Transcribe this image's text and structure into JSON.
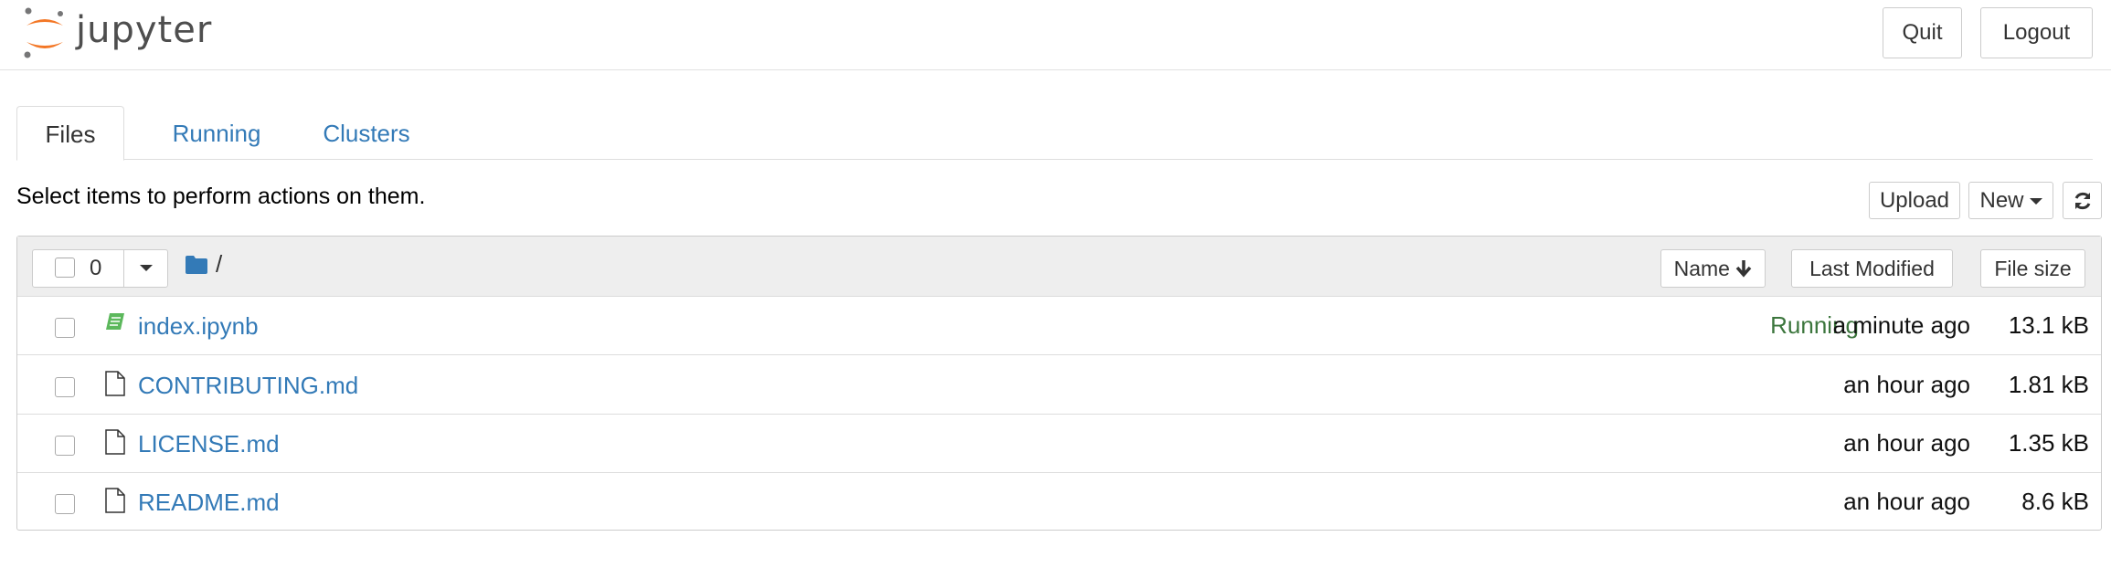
{
  "app": {
    "logo_text": "jupyter"
  },
  "header": {
    "quit_label": "Quit",
    "logout_label": "Logout"
  },
  "tabs": [
    {
      "label": "Files",
      "active": true
    },
    {
      "label": "Running",
      "active": false
    },
    {
      "label": "Clusters",
      "active": false
    }
  ],
  "toolbar": {
    "instructions": "Select items to perform actions on them.",
    "upload_label": "Upload",
    "new_label": "New",
    "refresh_icon": "refresh-icon"
  },
  "list_header": {
    "selected_count": "0",
    "path": "/",
    "sort_name_label": "Name",
    "sort_name_icon": "arrow-down-icon",
    "sort_modified_label": "Last Modified",
    "sort_size_label": "File size"
  },
  "files": [
    {
      "name": "index.ipynb",
      "icon": "notebook-icon",
      "status": "Running",
      "modified": "a minute ago",
      "size": "13.1 kB"
    },
    {
      "name": "CONTRIBUTING.md",
      "icon": "file-icon",
      "status": "",
      "modified": "an hour ago",
      "size": "1.81 kB"
    },
    {
      "name": "LICENSE.md",
      "icon": "file-icon",
      "status": "",
      "modified": "an hour ago",
      "size": "1.35 kB"
    },
    {
      "name": "README.md",
      "icon": "file-icon",
      "status": "",
      "modified": "an hour ago",
      "size": "8.6 kB"
    }
  ],
  "colors": {
    "link": "#337ab7",
    "running": "#3c763d",
    "logo_orange": "#f37726",
    "folder": "#337ab7",
    "notebook": "#5cb85c"
  }
}
